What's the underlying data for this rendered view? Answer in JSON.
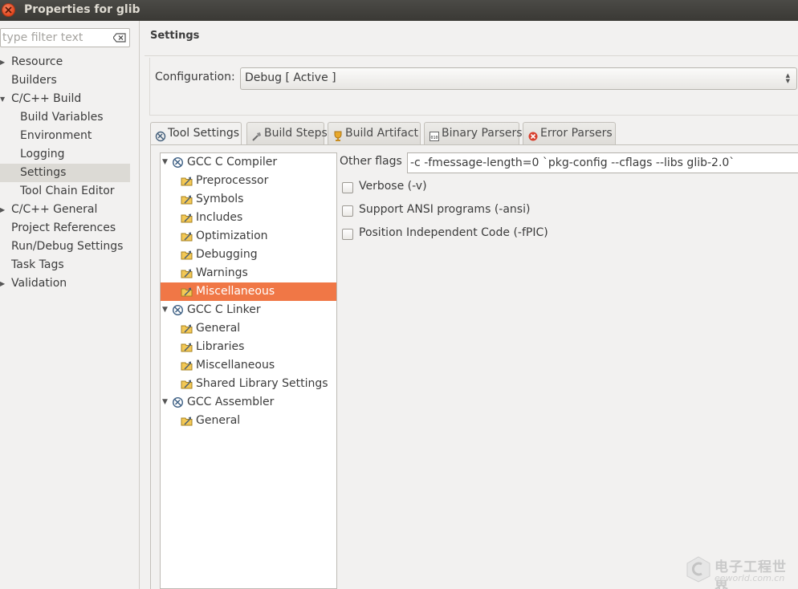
{
  "window": {
    "title": "Properties for glib",
    "close_icon": "close-icon",
    "close_color": "#e4481f"
  },
  "sidebar": {
    "filter_placeholder": "type filter text",
    "items": [
      {
        "label": "Resource",
        "expandable": true
      },
      {
        "label": "Builders",
        "expandable": false
      },
      {
        "label": "C/C++ Build",
        "expandable": true,
        "expanded": true
      },
      {
        "label": "Build Variables",
        "child": true
      },
      {
        "label": "Environment",
        "child": true
      },
      {
        "label": "Logging",
        "child": true
      },
      {
        "label": "Settings",
        "child": true,
        "selected": true
      },
      {
        "label": "Tool Chain Editor",
        "child": true
      },
      {
        "label": "C/C++ General",
        "expandable": true
      },
      {
        "label": "Project References",
        "expandable": false
      },
      {
        "label": "Run/Debug Settings",
        "expandable": false
      },
      {
        "label": "Task Tags",
        "expandable": false
      },
      {
        "label": "Validation",
        "expandable": true
      }
    ]
  },
  "main": {
    "title": "Settings",
    "configuration": {
      "label": "Configuration:",
      "value": "Debug  [ Active ]"
    },
    "tabs": [
      {
        "label": "Tool Settings",
        "icon": "tool-settings-icon",
        "active": true
      },
      {
        "label": "Build Steps",
        "icon": "build-steps-icon"
      },
      {
        "label": "Build Artifact",
        "icon": "trophy-icon"
      },
      {
        "label": "Binary Parsers",
        "icon": "binary-icon"
      },
      {
        "label": "Error Parsers",
        "icon": "error-icon"
      }
    ],
    "tool_tree": [
      {
        "label": "GCC C Compiler",
        "level": 0,
        "icon": "gcc-tool-icon"
      },
      {
        "label": "Preprocessor",
        "level": 1,
        "icon": "option-folder-icon"
      },
      {
        "label": "Symbols",
        "level": 1,
        "icon": "option-folder-icon"
      },
      {
        "label": "Includes",
        "level": 1,
        "icon": "option-folder-icon"
      },
      {
        "label": "Optimization",
        "level": 1,
        "icon": "option-folder-icon"
      },
      {
        "label": "Debugging",
        "level": 1,
        "icon": "option-folder-icon"
      },
      {
        "label": "Warnings",
        "level": 1,
        "icon": "option-folder-icon"
      },
      {
        "label": "Miscellaneous",
        "level": 1,
        "icon": "option-folder-icon",
        "selected": true
      },
      {
        "label": "GCC C Linker",
        "level": 0,
        "icon": "gcc-tool-icon"
      },
      {
        "label": "General",
        "level": 1,
        "icon": "option-folder-icon"
      },
      {
        "label": "Libraries",
        "level": 1,
        "icon": "option-folder-icon"
      },
      {
        "label": "Miscellaneous",
        "level": 1,
        "icon": "option-folder-icon"
      },
      {
        "label": "Shared Library Settings",
        "level": 1,
        "icon": "option-folder-icon"
      },
      {
        "label": "GCC Assembler",
        "level": 0,
        "icon": "gcc-tool-icon"
      },
      {
        "label": "General",
        "level": 1,
        "icon": "option-folder-icon"
      }
    ],
    "options": {
      "other_flags_label": "Other flags",
      "other_flags_value": "-c -fmessage-length=0 `pkg-config --cflags --libs glib-2.0`",
      "checkboxes": [
        {
          "label": "Verbose (-v)",
          "checked": false
        },
        {
          "label": "Support ANSI programs (-ansi)",
          "checked": false
        },
        {
          "label": "Position Independent Code (-fPIC)",
          "checked": false
        }
      ]
    },
    "selection_color": "#f07746"
  },
  "watermark": {
    "brand": "电子工程世界",
    "site": "eeworld.com.cn"
  }
}
